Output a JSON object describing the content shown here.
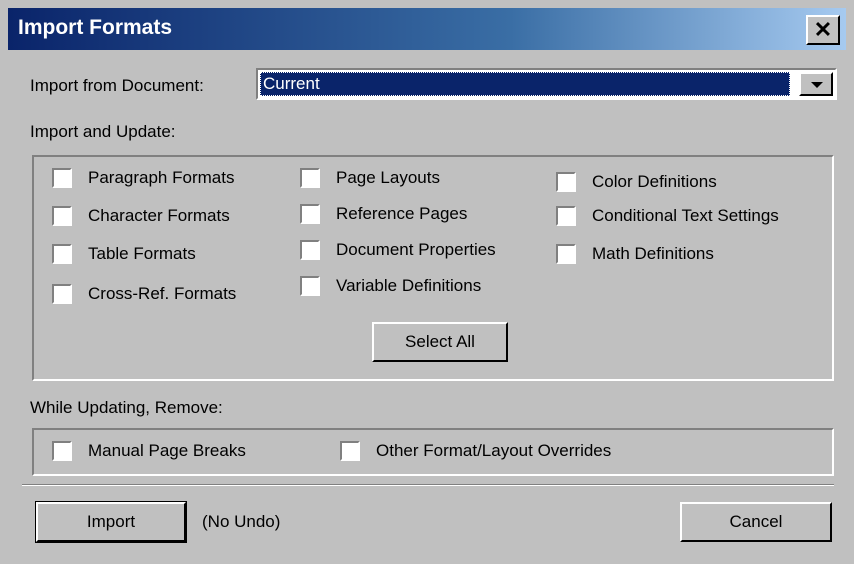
{
  "window": {
    "title": "Import Formats",
    "close_label": "✕"
  },
  "import_from": {
    "label": "Import from Document:",
    "value": "Current"
  },
  "import_update": {
    "label": "Import and Update:",
    "col1": [
      "Paragraph Formats",
      "Character Formats",
      "Table Formats",
      "Cross-Ref. Formats"
    ],
    "col2": [
      "Page Layouts",
      "Reference Pages",
      "Document Properties",
      "Variable Definitions"
    ],
    "col3": [
      "Color Definitions",
      "Conditional Text Settings",
      "Math Definitions"
    ],
    "select_all": "Select All"
  },
  "while_updating": {
    "label": "While Updating, Remove:",
    "options": [
      "Manual Page Breaks",
      "Other Format/Layout Overrides"
    ]
  },
  "footer": {
    "import_button": "Import",
    "no_undo": "(No Undo)",
    "cancel_button": "Cancel"
  },
  "colors": {
    "title_bar": "#0a246a",
    "face": "#c0c0c0",
    "selection": "#0a246a"
  }
}
